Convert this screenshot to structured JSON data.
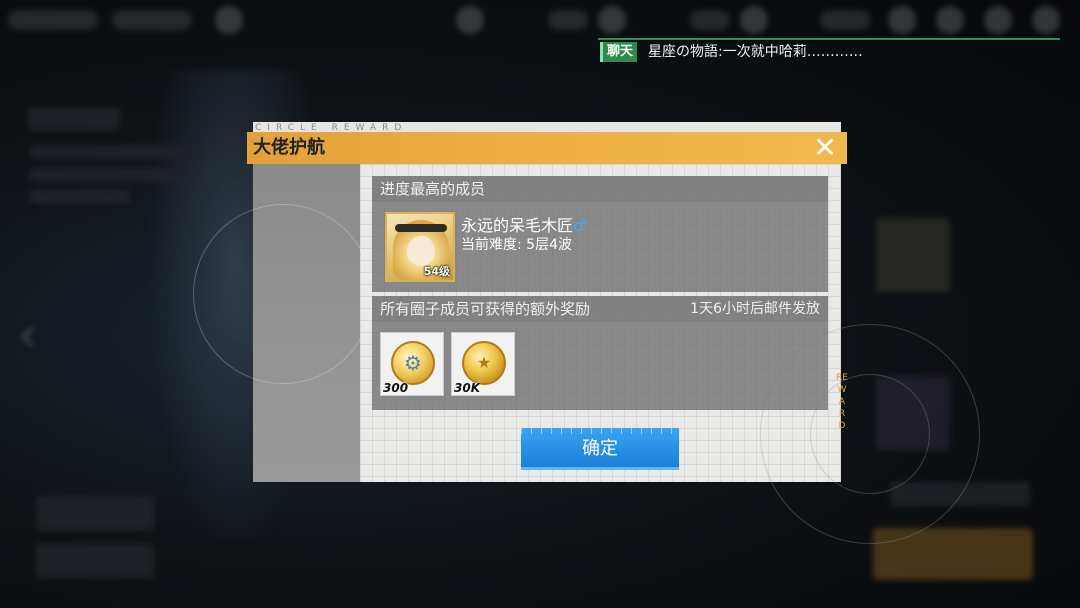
{
  "chat": {
    "tag": "聊天",
    "message": "星座の物語:一次就中哈莉…………"
  },
  "dialog": {
    "title": "大佬护航",
    "circle_text": "CIRCLE REWARD",
    "reward_vertical": "REWARD",
    "close_icon": "close-icon",
    "top_member": {
      "section_title": "进度最高的成员",
      "level": "54级",
      "name": "永远的呆毛木匠",
      "gender_symbol": "♂",
      "difficulty": "当前难度: 5层4波"
    },
    "extra_reward": {
      "section_title": "所有圈子成员可获得的额外奖励",
      "delivery_note": "1天6小时后邮件发放",
      "items": [
        {
          "icon": "badge-coin-icon",
          "count": "300"
        },
        {
          "icon": "gold-coin-icon",
          "count": "30K"
        }
      ]
    },
    "confirm_label": "确定"
  },
  "colors": {
    "title_bar": "#efb347",
    "confirm": "#1d7fd8",
    "chat_tag": "#2f8a4f",
    "gender": "#45a6ff"
  }
}
